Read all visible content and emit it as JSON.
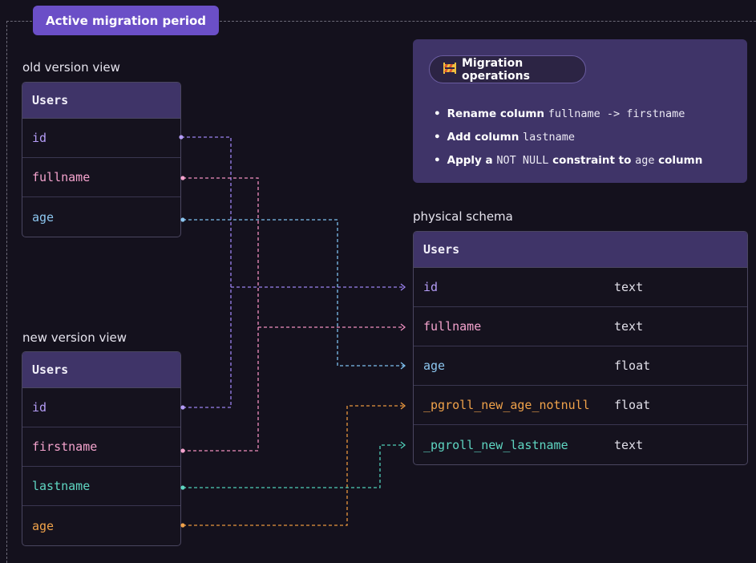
{
  "badge": "Active migration period",
  "old_view": {
    "label": "old version view",
    "table": "Users",
    "columns": [
      "id",
      "fullname",
      "age"
    ]
  },
  "new_view": {
    "label": "new version view",
    "table": "Users",
    "columns": [
      "id",
      "firstname",
      "lastname",
      "age"
    ]
  },
  "physical": {
    "label": "physical schema",
    "table": "Users",
    "rows": [
      {
        "name": "id",
        "type": "text"
      },
      {
        "name": "fullname",
        "type": "text"
      },
      {
        "name": "age",
        "type": "float"
      },
      {
        "name": "_pgroll_new_age_notnull",
        "type": "float"
      },
      {
        "name": "_pgroll_new_lastname",
        "type": "text"
      }
    ]
  },
  "operations": {
    "title": "Migration operations",
    "icon": "construction-barrier-icon",
    "items": [
      {
        "before": "Rename column ",
        "code": "fullname -> firstname",
        "after": ""
      },
      {
        "before": "Add column ",
        "code": "lastname",
        "after": ""
      },
      {
        "before": "Apply a ",
        "code": "NOT NULL",
        "after": " constraint to ",
        "code2": "age",
        "after2": " column"
      }
    ]
  },
  "colors": {
    "background": "#14111d",
    "badge": "#6b4fc7",
    "header": "#3f3468",
    "purple": "#b49cf6",
    "pink": "#f4a3cd",
    "blue": "#8cc6ef",
    "teal": "#5fd6c2",
    "orange": "#f0a24a"
  }
}
